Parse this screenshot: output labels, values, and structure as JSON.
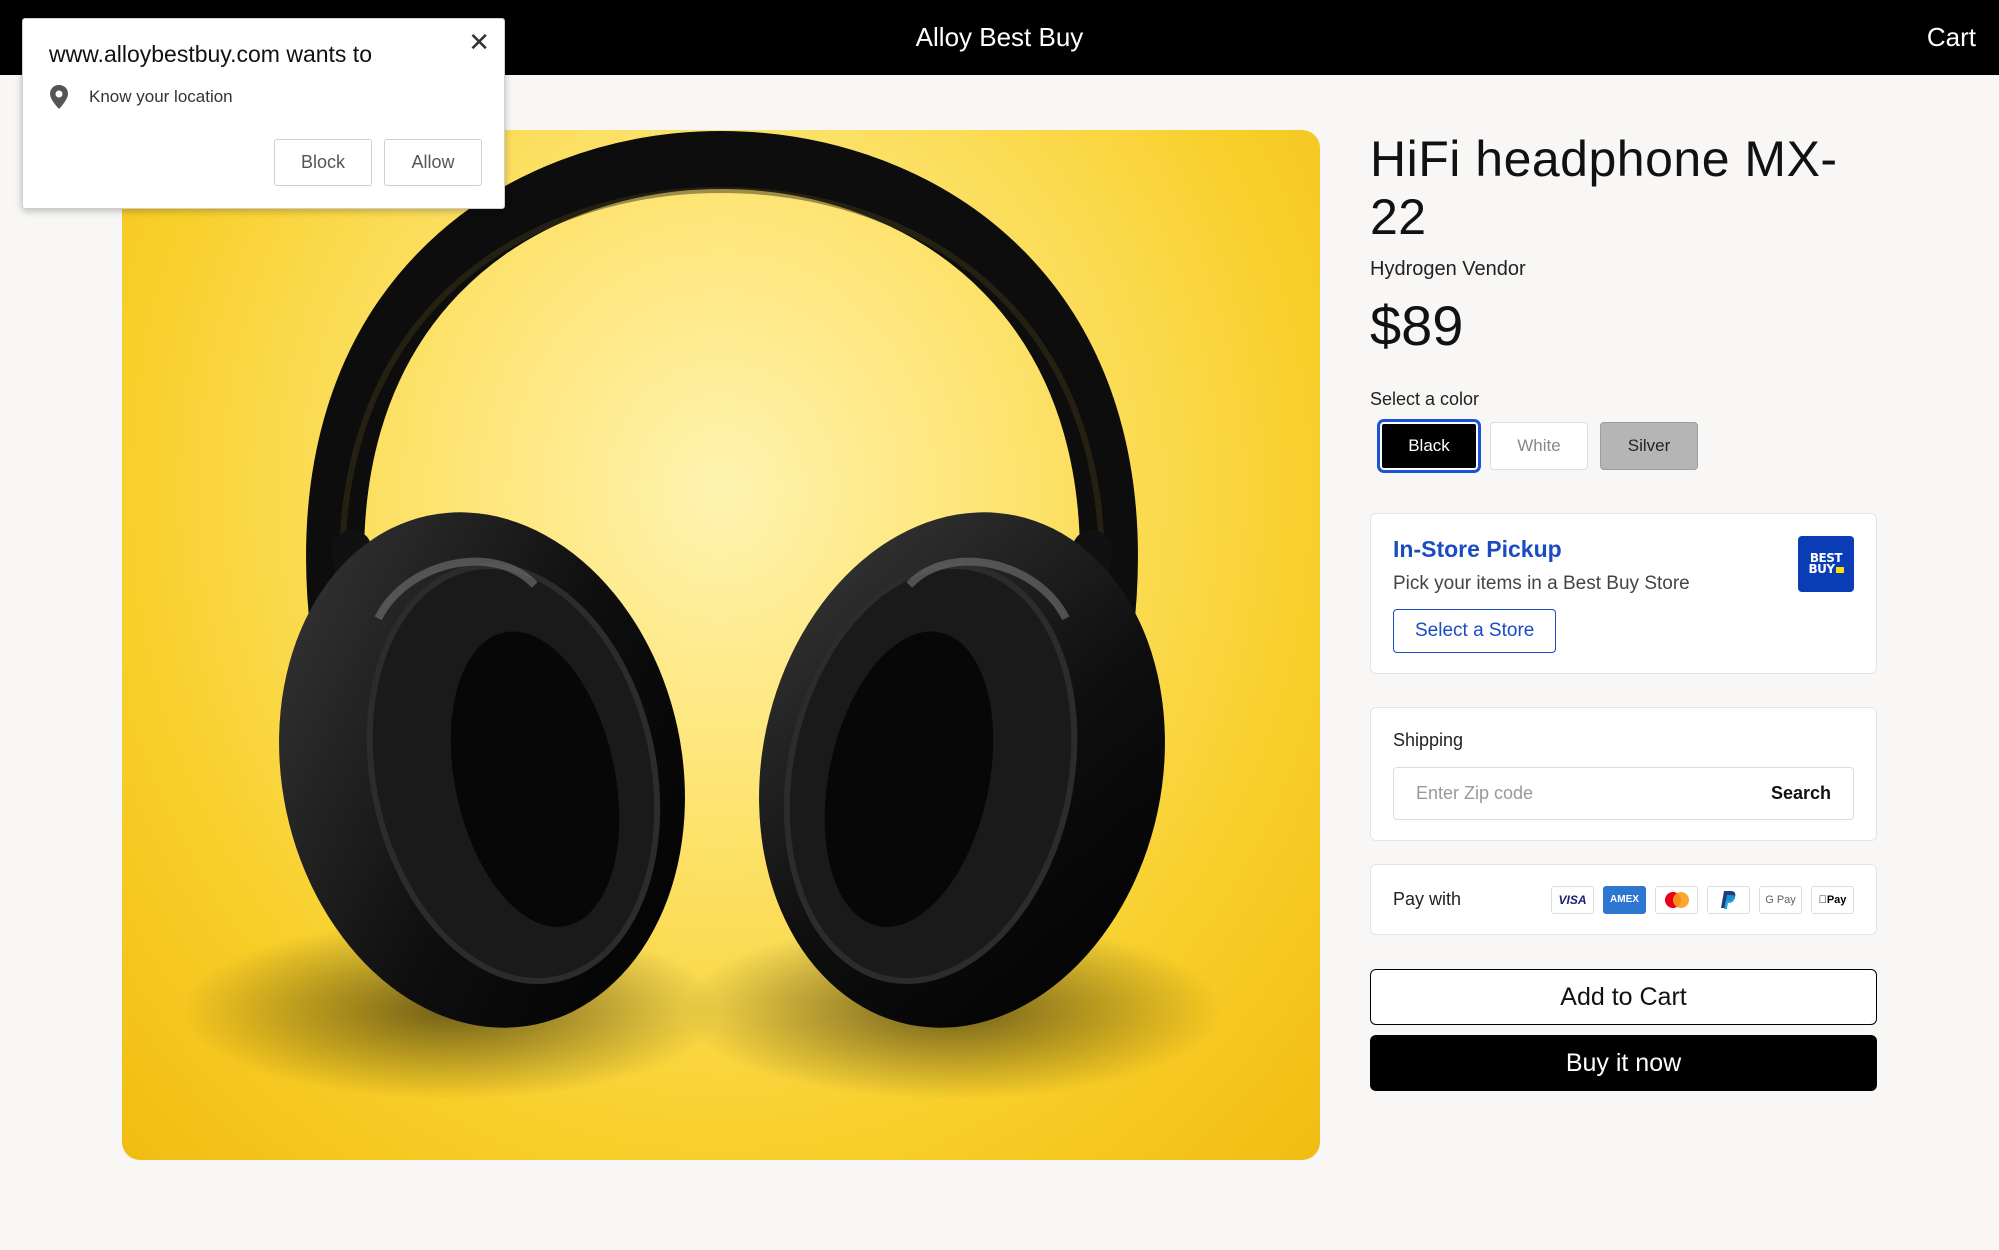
{
  "header": {
    "brand": "Alloy Best Buy",
    "cart_label": "Cart"
  },
  "permission_popup": {
    "title": "www.alloybestbuy.com wants to",
    "close_icon": "close-icon",
    "item_icon": "location-pin-icon",
    "item_label": "Know your location",
    "block_label": "Block",
    "allow_label": "Allow"
  },
  "product": {
    "title": "HiFi headphone MX-22",
    "vendor": "Hydrogen Vendor",
    "price": "$89",
    "color_label": "Select a color",
    "colors": [
      {
        "label": "Black",
        "selected": true,
        "bg": "#000000"
      },
      {
        "label": "White",
        "selected": false,
        "bg": "#ffffff"
      },
      {
        "label": "Silver",
        "selected": false,
        "bg": "#b5b5b5"
      }
    ],
    "image_subject": "black over-ear headphones on yellow background"
  },
  "pickup": {
    "title": "In-Store Pickup",
    "subtitle": "Pick your items in a Best Buy Store",
    "button_label": "Select a Store",
    "logo_line1": "BEST",
    "logo_line2": "BUY"
  },
  "shipping": {
    "label": "Shipping",
    "zip_placeholder": "Enter Zip code",
    "zip_value": "",
    "search_label": "Search"
  },
  "payment": {
    "label": "Pay with",
    "methods": [
      "VISA",
      "AMEX",
      "Mastercard",
      "PayPal",
      "G Pay",
      "Apple Pay"
    ],
    "method_texts": {
      "visa": "VISA",
      "amex": "AMEX",
      "gpay": "G Pay",
      "apay": "Pay"
    }
  },
  "actions": {
    "add_to_cart": "Add to Cart",
    "buy_now": "Buy it now"
  },
  "colors": {
    "accent_blue": "#1a4bc3",
    "bby_blue": "#0a3db5",
    "bby_yellow": "#ffe000",
    "topbar": "#000000"
  }
}
